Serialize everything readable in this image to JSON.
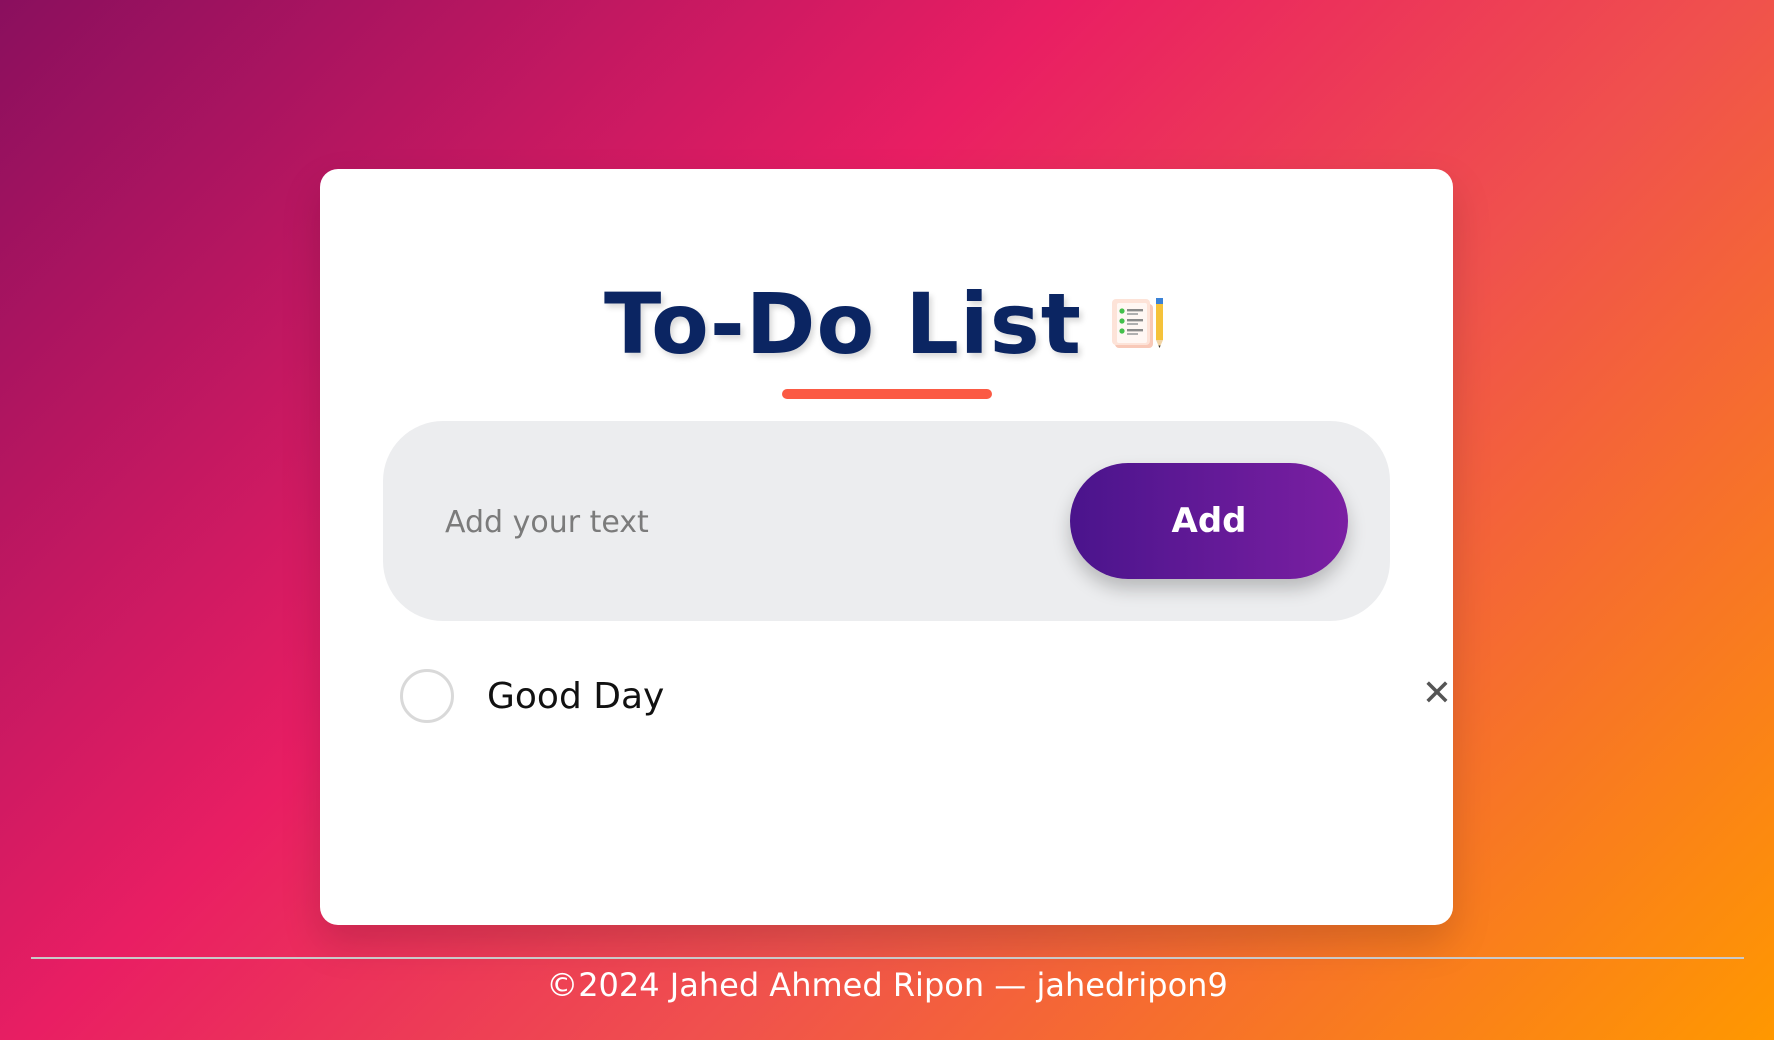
{
  "app": {
    "title": "To-Do List",
    "title_icon": "notepad-pencil-icon"
  },
  "input": {
    "placeholder": "Add your text",
    "value": ""
  },
  "add_button": {
    "label": "Add"
  },
  "todos": [
    {
      "text": "Good Day",
      "checked": false,
      "delete_icon": "close-icon",
      "delete_glyph": "✕"
    }
  ],
  "footer": {
    "text": "©2024 Jahed Ahmed Ripon — jahedripon9"
  },
  "colors": {
    "title": "#0b2562",
    "accent_underline": "#fb5a44",
    "button_start": "#4a148c",
    "button_end": "#7b1fa2",
    "input_bg": "#ecedef"
  }
}
